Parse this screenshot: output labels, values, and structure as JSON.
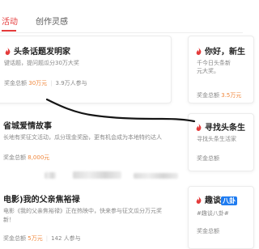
{
  "tabs": {
    "active": "活动",
    "idle": "创作灵感"
  },
  "cards": {
    "card1": {
      "title": "头条话题发明家",
      "desc": "键话题，提问题瓜分30万大奖",
      "prize_label": "奖金总额",
      "prize_value": "30万元",
      "participants": "3.9万人参与"
    },
    "card2": {
      "title": "你好，新生",
      "desc": "千今日头条新",
      "desc2": "元大奖。",
      "prize_label": "奖金总额",
      "prize_value": "3.5万元"
    },
    "card3": {
      "title": "省城爱情故事",
      "desc": "长地有奖征文活动，瓜分现金奖励，更有机会成为本地特约达人",
      "prize_label": "奖金总额",
      "prize_value": "8,000元"
    },
    "card4": {
      "title": "寻找头条生",
      "desc": "寻找头条生活家",
      "prize_label": "奖金总额"
    },
    "card5": {
      "title": "电影)我的父亲焦裕禄",
      "desc": "电影《我的父亲焦裕禄》正在热映中，快来参与征文瓜分万元奖",
      "desc2": "新！",
      "prize_label": "奖金总额",
      "prize_value": "5万元",
      "participants": "142 人参与"
    },
    "card6": {
      "title": "趣谈",
      "tag": "八卦",
      "desc": "#趣谈八卦#",
      "prize_label": "奖金总额"
    }
  },
  "colors": {
    "accent": "#e43b3b",
    "prize": "#f0883e",
    "tag": "#1e7bf0"
  }
}
